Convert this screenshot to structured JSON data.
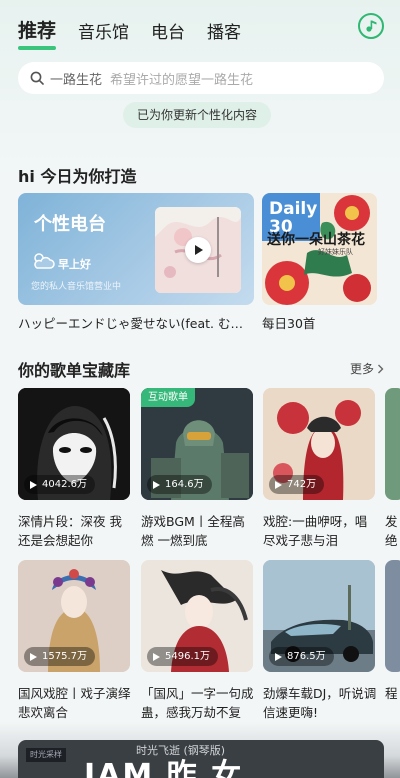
{
  "tabs": [
    {
      "label": "推荐",
      "active": true
    },
    {
      "label": "音乐馆",
      "active": false
    },
    {
      "label": "电台",
      "active": false
    },
    {
      "label": "播客",
      "active": false
    }
  ],
  "search": {
    "keyword": "一路生花",
    "hint": "希望许过的愿望一路生花"
  },
  "toast": "已为你更新个性化内容",
  "today": {
    "title": "hi 今日为你打造",
    "radio": {
      "title": "个性电台",
      "greeting": "早上好",
      "subtitle": "您的私人音乐馆营业中",
      "caption": "ハッピーエンドじゃ愛せない(feat. む…"
    },
    "daily": {
      "badge_word": "Daily",
      "badge_num": "30",
      "cover_text": "送你一朵山茶花",
      "cover_sub": "好妹妹乐队",
      "caption": "每日30首"
    }
  },
  "playlists": {
    "title": "你的歌单宝藏库",
    "more": "更多",
    "items": [
      {
        "count": "4042.6万",
        "caption": "深情片段：深夜 我还是会想起你",
        "badge": ""
      },
      {
        "count": "164.6万",
        "caption": "游戏BGM丨全程高燃 一燃到底",
        "badge": "互动歌单"
      },
      {
        "count": "742万",
        "caption": "戏腔:一曲咿呀，唱尽戏子悲与泪",
        "badge": ""
      },
      {
        "count": "",
        "caption": "发绝",
        "badge": ""
      },
      {
        "count": "1575.7万",
        "caption": "国风戏腔丨戏子演绎悲欢离合",
        "badge": ""
      },
      {
        "count": "5496.1万",
        "caption": "「国风」一字一句成蛊，感我万劫不复",
        "badge": ""
      },
      {
        "count": "876.5万",
        "caption": "劲爆车载DJ，听说调信速更嗨!",
        "badge": ""
      },
      {
        "count": "",
        "caption": "程",
        "badge": ""
      }
    ]
  },
  "mini_player": {
    "tag": "时光采样",
    "text": "时光飞逝 (钢琴版)",
    "big": "IAM 昨 女"
  },
  "colors": {
    "accent": "#3bc47c",
    "radio_card": "#8dbbe0"
  }
}
